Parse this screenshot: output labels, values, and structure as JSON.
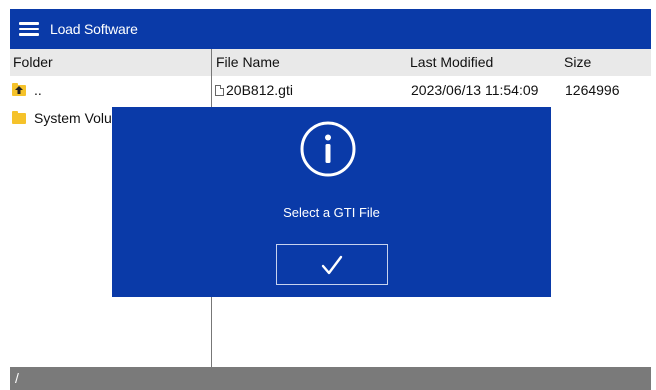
{
  "header": {
    "title": "Load Software",
    "menu_icon": "hamburger-menu-icon"
  },
  "columns": {
    "folder": "Folder",
    "file_name": "File Name",
    "last_modified": "Last Modified",
    "size": "Size"
  },
  "folders": [
    {
      "label": "..",
      "icon": "parent-folder-icon"
    },
    {
      "label": "System Volu",
      "icon": "folder-icon"
    }
  ],
  "files": [
    {
      "name": "20B812.gti",
      "last_modified": "2023/06/13 11:54:09",
      "size": "1264996",
      "icon": "file-icon"
    }
  ],
  "dialog": {
    "icon": "info-icon",
    "message": "Select a GTI File",
    "confirm_icon": "checkmark-icon"
  },
  "status": {
    "path": "/"
  },
  "colors": {
    "primary": "#0a3aa8",
    "header_bg": "#e9e9e9",
    "status_bg": "#7a7a7a",
    "folder": "#f5c22a"
  }
}
